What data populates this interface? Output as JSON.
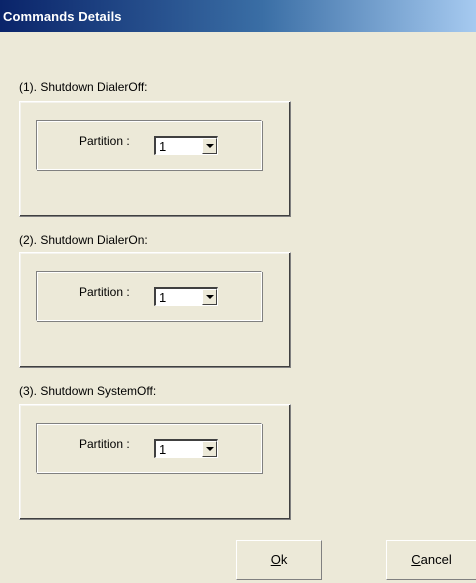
{
  "window": {
    "title": "Commands Details"
  },
  "sections": [
    {
      "label": "(1). Shutdown DialerOff:",
      "partition_label": "Partition :",
      "partition_value": "1"
    },
    {
      "label": "(2). Shutdown DialerOn:",
      "partition_label": "Partition :",
      "partition_value": "1"
    },
    {
      "label": "(3). Shutdown SystemOff:",
      "partition_label": "Partition :",
      "partition_value": "1"
    }
  ],
  "buttons": {
    "ok": {
      "mnemonic": "O",
      "rest": "k"
    },
    "cancel": {
      "mnemonic": "C",
      "rest": "ancel"
    }
  }
}
